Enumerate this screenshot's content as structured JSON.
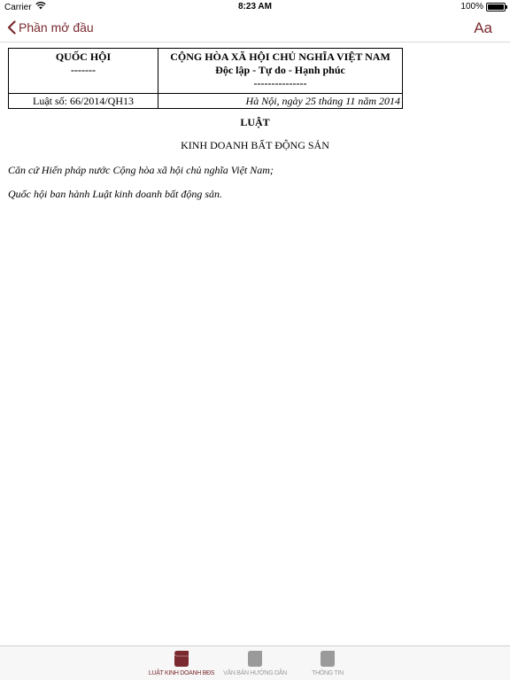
{
  "status_bar": {
    "carrier": "Carrier",
    "time": "8:23 AM",
    "battery": "100%",
    "icons": [
      "wifi-icon",
      "battery-icon"
    ]
  },
  "nav": {
    "back_label": "Phần mở đầu",
    "back_icon": "chevron-left-icon",
    "font_button": "Aa",
    "accent_color": "#7a2a2f"
  },
  "document": {
    "header": {
      "left_title": "QUỐC HỘI",
      "left_dashes": "-------",
      "right_title": "CỘNG HÒA XÃ HỘI CHỦ NGHĨA VIỆT NAM",
      "right_motto": "Độc lập - Tự do - Hạnh phúc",
      "right_dashes": "---------------",
      "number": "Luật số: 66/2014/QH13",
      "date": "Hà Nội, ngày 25 tháng 11 năm 2014"
    },
    "law_title": "LUẬT",
    "law_name": "KINH DOANH BẤT ĐỘNG SẢN",
    "paragraphs": [
      "Căn cứ Hiến pháp nước Cộng hòa xã hội chủ nghĩa Việt Nam;",
      "Quốc hội ban hành Luật kinh doanh bất động sản."
    ]
  },
  "tabs": [
    {
      "label": "LUẬT KINH DOANH BĐS",
      "icon": "law-book-icon",
      "active": true
    },
    {
      "label": "VĂN BẢN HƯỚNG DẪN",
      "icon": "document-icon",
      "active": false
    },
    {
      "label": "THÔNG TIN",
      "icon": "info-icon",
      "active": false
    }
  ]
}
